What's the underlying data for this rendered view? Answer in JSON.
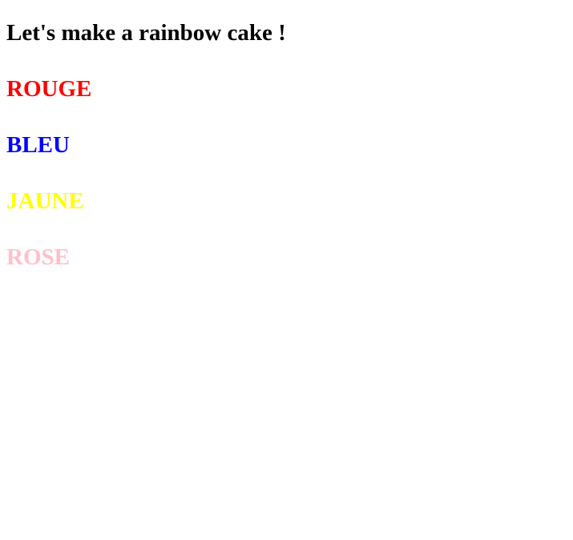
{
  "title": "Let's make a rainbow cake !",
  "colors": [
    {
      "label": "ROUGE",
      "color": "#ff0000"
    },
    {
      "label": "BLEU",
      "color": "#0000ff"
    },
    {
      "label": "JAUNE",
      "color": "#ffff00"
    },
    {
      "label": "ROSE",
      "color": "#ffc0cb"
    }
  ]
}
